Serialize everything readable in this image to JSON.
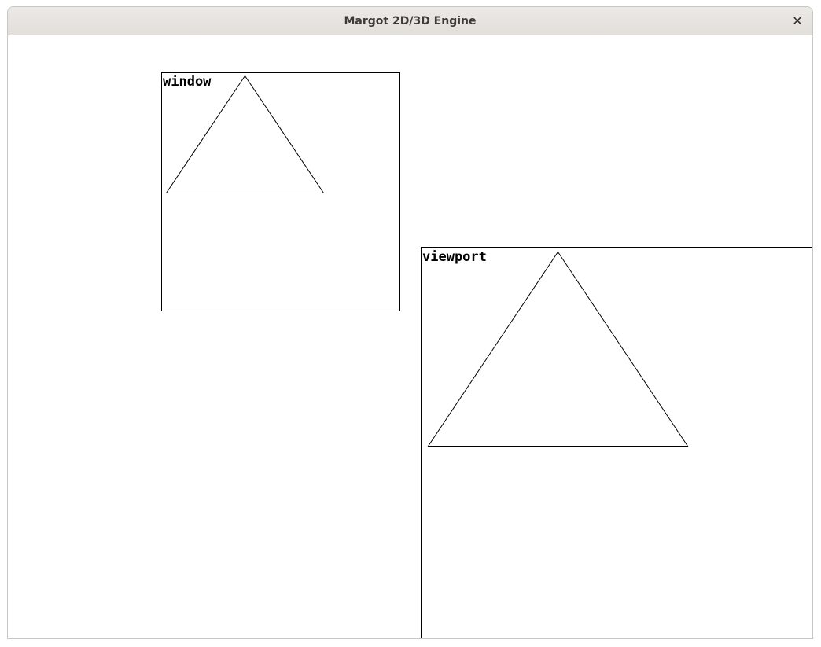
{
  "window": {
    "title": "Margot 2D/3D Engine",
    "close_glyph": "✕",
    "close_icon": "close-icon"
  },
  "scene": {
    "stroke_color": "#000000",
    "background_color": "#ffffff",
    "window_panel": {
      "label": "window"
    },
    "viewport_panel": {
      "label": "viewport"
    }
  }
}
